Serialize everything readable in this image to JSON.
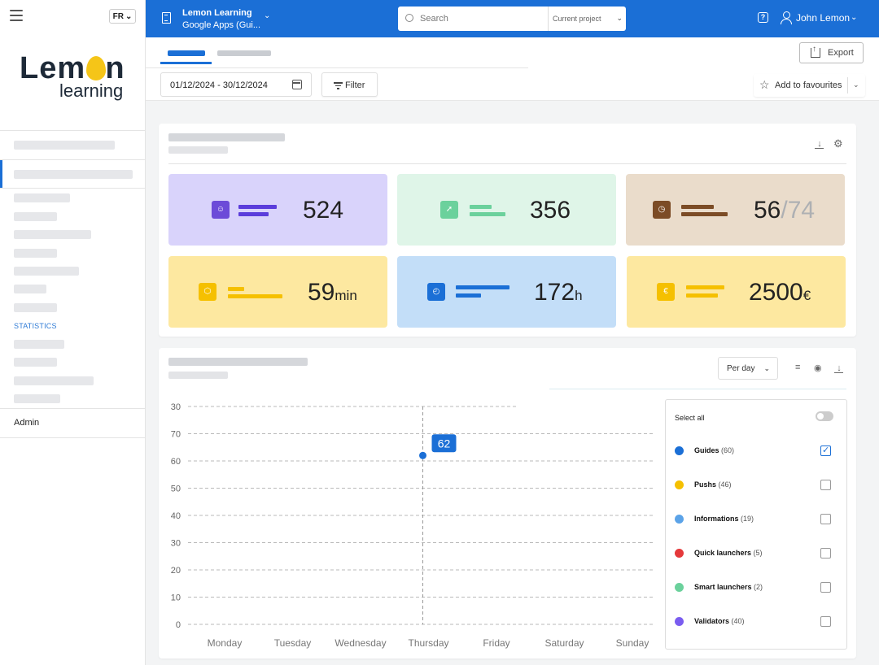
{
  "sidebar": {
    "lang": "FR",
    "logo_main": "Lemon",
    "logo_sub": "learning",
    "section_label": "STATISTICS",
    "admin_label": "Admin"
  },
  "topbar": {
    "project_name": "Lemon Learning",
    "project_sub": "Google Apps (Gui...",
    "search_placeholder": "Search",
    "search_scope": "Current project",
    "help_icon": "?",
    "user_name": "John Lemon"
  },
  "toolbar": {
    "export_label": "Export",
    "date_range": "01/12/2024 - 30/12/2024",
    "filter_label": "Filter",
    "favourites_label": "Add to favourites"
  },
  "kpis": [
    {
      "value": "524",
      "unit": "",
      "denom": "",
      "color": "#d9d3fb",
      "icon_color": "#6c4bd8",
      "bar_color": "#5b3ddb",
      "icon": "user-pin-icon"
    },
    {
      "value": "356",
      "unit": "",
      "denom": "",
      "color": "#dff5e8",
      "icon_color": "#6bd19c",
      "bar_color": "#6bd19c",
      "icon": "cursor-icon"
    },
    {
      "value": "56",
      "unit": "",
      "denom": "/74",
      "color": "#eadccb",
      "icon_color": "#7c4c26",
      "bar_color": "#7c4c26",
      "icon": "clock-icon"
    },
    {
      "value": "59",
      "unit": "min",
      "denom": "",
      "color": "#fde8a0",
      "icon_color": "#f5c000",
      "bar_color": "#f5c000",
      "icon": "coin-icon"
    },
    {
      "value": "172",
      "unit": "h",
      "denom": "",
      "color": "#c3def8",
      "icon_color": "#1b6fd6",
      "bar_color": "#1b6fd6",
      "icon": "stopwatch-icon"
    },
    {
      "value": "2500",
      "unit": "€",
      "denom": "",
      "color": "#fde8a0",
      "icon_color": "#f5c000",
      "bar_color": "#f5c000",
      "icon": "euro-icon"
    }
  ],
  "chart_controls": {
    "period_label": "Per day"
  },
  "chart_data": {
    "type": "line",
    "categories": [
      "Monday",
      "Tuesday",
      "Wednesday",
      "Thursday",
      "Friday",
      "Saturday",
      "Sunday"
    ],
    "y_ticks": [
      "0",
      "10",
      "20",
      "30",
      "40",
      "50",
      "60",
      "70",
      "30"
    ],
    "ylim": [
      0,
      80
    ],
    "grid": true,
    "series": [
      {
        "name": "Guides",
        "color": "#1b6fd6",
        "points": [
          {
            "x": "Thursday",
            "y": 62
          }
        ]
      }
    ],
    "tooltip": {
      "x": "Thursday",
      "value": "62"
    }
  },
  "legend": {
    "select_all": "Select all",
    "items": [
      {
        "name": "Guides",
        "count": "(60)",
        "color": "#1b6fd6",
        "checked": true
      },
      {
        "name": "Pushs",
        "count": "(46)",
        "color": "#f5c000",
        "checked": false
      },
      {
        "name": "Informations",
        "count": "(19)",
        "color": "#5ba3e8",
        "checked": false
      },
      {
        "name": "Quick launchers",
        "count": "(5)",
        "color": "#e5393b",
        "checked": false
      },
      {
        "name": "Smart launchers",
        "count": "(2)",
        "color": "#6bd19c",
        "checked": false
      },
      {
        "name": "Validators",
        "count": "(40)",
        "color": "#7a5cf0",
        "checked": false
      }
    ]
  }
}
